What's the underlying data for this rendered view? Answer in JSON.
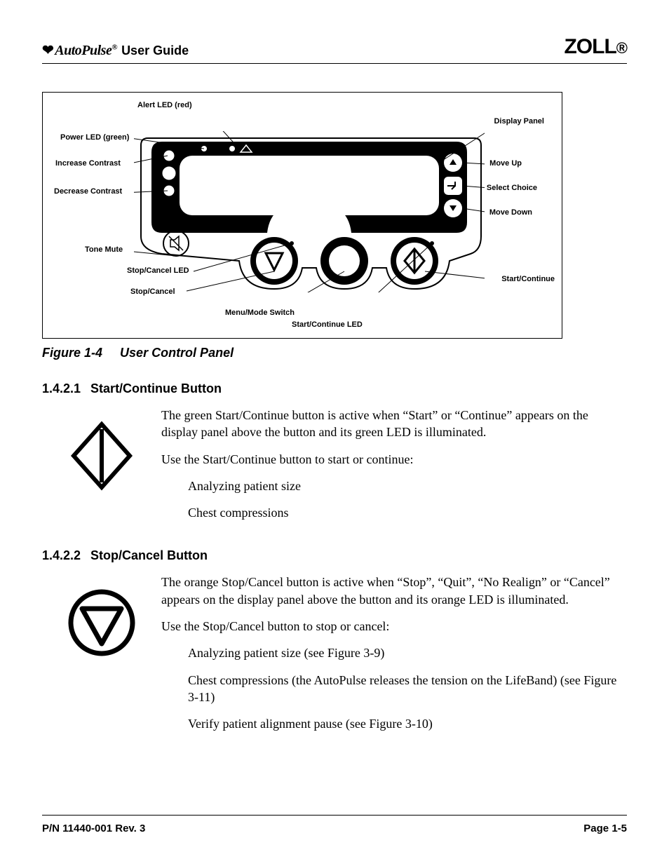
{
  "header": {
    "brand": "AutoPulse",
    "reg": "®",
    "guide": "User Guide",
    "company": "ZOLL",
    "company_reg": "®"
  },
  "figure": {
    "labels": {
      "alert_led": "Alert LED (red)",
      "power_led": "Power LED (green)",
      "increase_contrast": "Increase Contrast",
      "decrease_contrast": "Decrease Contrast",
      "tone_mute": "Tone Mute",
      "stop_cancel_led": "Stop/Cancel LED",
      "stop_cancel": "Stop/Cancel",
      "menu_mode": "Menu/Mode Switch",
      "start_continue_led": "Start/Continue LED",
      "display_panel": "Display Panel",
      "move_up": "Move Up",
      "select_choice": "Select Choice",
      "move_down": "Move Down",
      "start_continue": "Start/Continue"
    },
    "caption_num": "Figure 1-4",
    "caption_text": "User Control Panel"
  },
  "sections": {
    "s1": {
      "num": "1.4.2.1",
      "title": "Start/Continue Button",
      "p1": "The green Start/Continue button is active when “Start” or “Continue” appears on the display panel above the button and its green LED is illuminated.",
      "p2": "Use the Start/Continue button to start or continue:",
      "li1": "Analyzing patient size",
      "li2": "Chest compressions"
    },
    "s2": {
      "num": "1.4.2.2",
      "title": "Stop/Cancel Button",
      "p1": "The orange Stop/Cancel button is active when “Stop”, “Quit”, “No Realign” or “Cancel” appears on the display panel above the button and its orange LED is illuminated.",
      "p2": "Use the Stop/Cancel button to stop or cancel:",
      "li1": "Analyzing patient size (see Figure 3-9)",
      "li2": "Chest compressions (the AutoPulse releases the tension on the LifeBand) (see Figure 3-11)",
      "li3": "Verify patient alignment pause (see Figure 3-10)"
    }
  },
  "footer": {
    "pn": "P/N 11440-001 Rev. 3",
    "page": "Page 1-5"
  }
}
